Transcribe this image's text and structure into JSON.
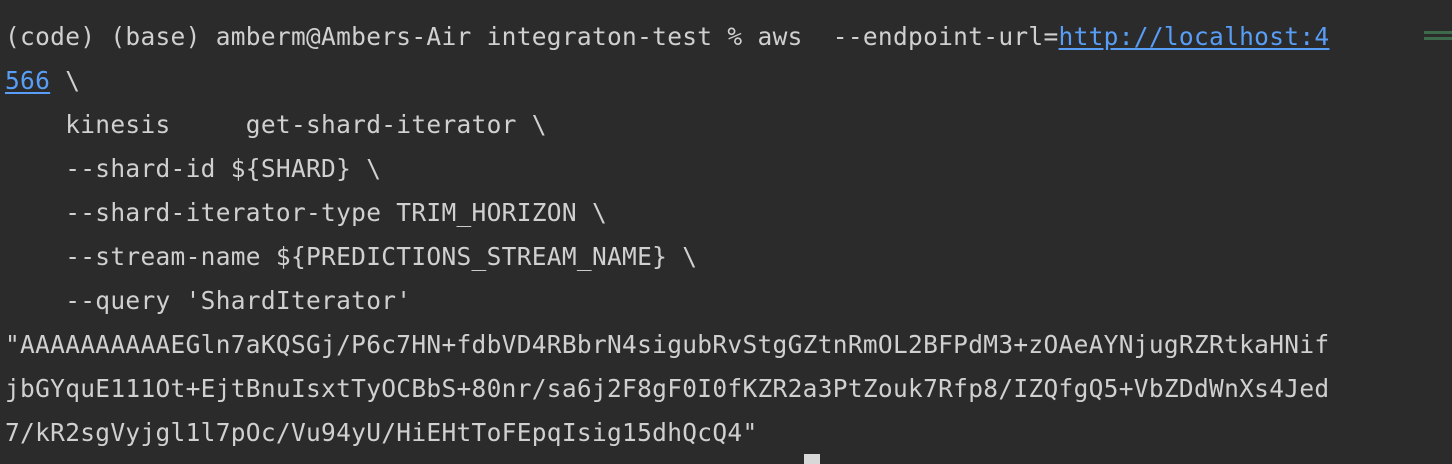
{
  "terminal": {
    "prompt": "(code) (base) amberm@Ambers-Air integraton-test % ",
    "command_start": "aws  --endpoint-url=",
    "url_part1": "http://localhost:4",
    "url_part2": "566",
    "line1_cont": " \\",
    "line2": "    kinesis     get-shard-iterator \\",
    "line3": "    --shard-id ${SHARD} \\",
    "line4": "    --shard-iterator-type TRIM_HORIZON \\",
    "line5": "    --stream-name ${PREDICTIONS_STREAM_NAME} \\",
    "line6": "    --query 'ShardIterator'",
    "output1": "\"AAAAAAAAAAEGln7aKQSGj/P6c7HN+fdbVD4RBbrN4sigubRvStgGZtnRmOL2BFPdM3+zOAeAYNjugRZRtkaHNif",
    "output2": "jbGYquE111Ot+EjtBnuIsxtTyOCBbS+80nr/sa6j2F8gF0I0fKZR2a3PtZouk7Rfp8/IZQfgQ5+VbZDdWnXs4Jed",
    "output3": "7/kR2sgVyjgl1l7pOc/Vu94yU/HiEHtToFEpqIsig15dhQcQ4\""
  }
}
